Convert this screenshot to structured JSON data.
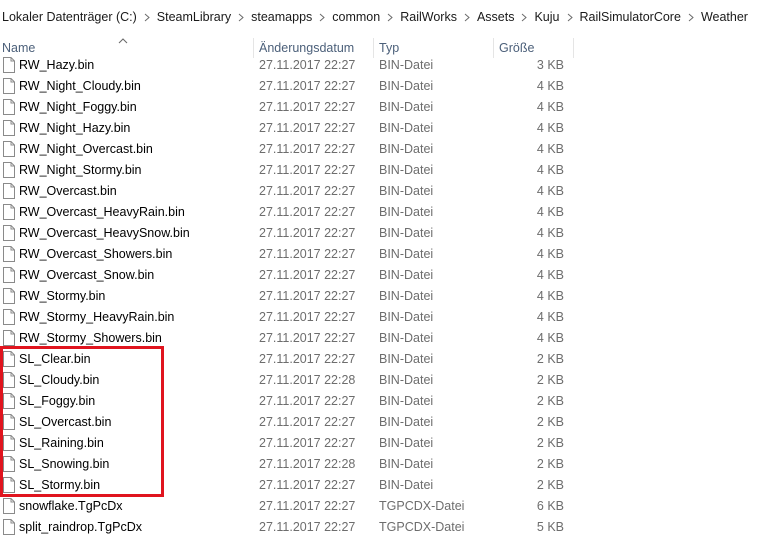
{
  "breadcrumb": [
    "Lokaler Datenträger (C:)",
    "SteamLibrary",
    "steamapps",
    "common",
    "RailWorks",
    "Assets",
    "Kuju",
    "RailSimulatorCore",
    "Weather"
  ],
  "columns": {
    "name": "Name",
    "date": "Änderungsdatum",
    "type": "Typ",
    "size": "Größe"
  },
  "sort": {
    "column": "name",
    "direction": "ascending"
  },
  "files": [
    {
      "name": "RW_Hazy.bin",
      "date": "27.11.2017 22:27",
      "type": "BIN-Datei",
      "size": "3 KB"
    },
    {
      "name": "RW_Night_Cloudy.bin",
      "date": "27.11.2017 22:27",
      "type": "BIN-Datei",
      "size": "4 KB"
    },
    {
      "name": "RW_Night_Foggy.bin",
      "date": "27.11.2017 22:27",
      "type": "BIN-Datei",
      "size": "4 KB"
    },
    {
      "name": "RW_Night_Hazy.bin",
      "date": "27.11.2017 22:27",
      "type": "BIN-Datei",
      "size": "4 KB"
    },
    {
      "name": "RW_Night_Overcast.bin",
      "date": "27.11.2017 22:27",
      "type": "BIN-Datei",
      "size": "4 KB"
    },
    {
      "name": "RW_Night_Stormy.bin",
      "date": "27.11.2017 22:27",
      "type": "BIN-Datei",
      "size": "4 KB"
    },
    {
      "name": "RW_Overcast.bin",
      "date": "27.11.2017 22:27",
      "type": "BIN-Datei",
      "size": "4 KB"
    },
    {
      "name": "RW_Overcast_HeavyRain.bin",
      "date": "27.11.2017 22:27",
      "type": "BIN-Datei",
      "size": "4 KB"
    },
    {
      "name": "RW_Overcast_HeavySnow.bin",
      "date": "27.11.2017 22:27",
      "type": "BIN-Datei",
      "size": "4 KB"
    },
    {
      "name": "RW_Overcast_Showers.bin",
      "date": "27.11.2017 22:27",
      "type": "BIN-Datei",
      "size": "4 KB"
    },
    {
      "name": "RW_Overcast_Snow.bin",
      "date": "27.11.2017 22:27",
      "type": "BIN-Datei",
      "size": "4 KB"
    },
    {
      "name": "RW_Stormy.bin",
      "date": "27.11.2017 22:27",
      "type": "BIN-Datei",
      "size": "4 KB"
    },
    {
      "name": "RW_Stormy_HeavyRain.bin",
      "date": "27.11.2017 22:27",
      "type": "BIN-Datei",
      "size": "4 KB"
    },
    {
      "name": "RW_Stormy_Showers.bin",
      "date": "27.11.2017 22:27",
      "type": "BIN-Datei",
      "size": "4 KB"
    },
    {
      "name": "SL_Clear.bin",
      "date": "27.11.2017 22:27",
      "type": "BIN-Datei",
      "size": "2 KB"
    },
    {
      "name": "SL_Cloudy.bin",
      "date": "27.11.2017 22:28",
      "type": "BIN-Datei",
      "size": "2 KB"
    },
    {
      "name": "SL_Foggy.bin",
      "date": "27.11.2017 22:27",
      "type": "BIN-Datei",
      "size": "2 KB"
    },
    {
      "name": "SL_Overcast.bin",
      "date": "27.11.2017 22:27",
      "type": "BIN-Datei",
      "size": "2 KB"
    },
    {
      "name": "SL_Raining.bin",
      "date": "27.11.2017 22:27",
      "type": "BIN-Datei",
      "size": "2 KB"
    },
    {
      "name": "SL_Snowing.bin",
      "date": "27.11.2017 22:28",
      "type": "BIN-Datei",
      "size": "2 KB"
    },
    {
      "name": "SL_Stormy.bin",
      "date": "27.11.2017 22:27",
      "type": "BIN-Datei",
      "size": "2 KB"
    },
    {
      "name": "snowflake.TgPcDx",
      "date": "27.11.2017 22:27",
      "type": "TGPCDX-Datei",
      "size": "6 KB"
    },
    {
      "name": "split_raindrop.TgPcDx",
      "date": "27.11.2017 22:27",
      "type": "TGPCDX-Datei",
      "size": "5 KB"
    }
  ],
  "annotation": {
    "color": "#e0141e"
  }
}
